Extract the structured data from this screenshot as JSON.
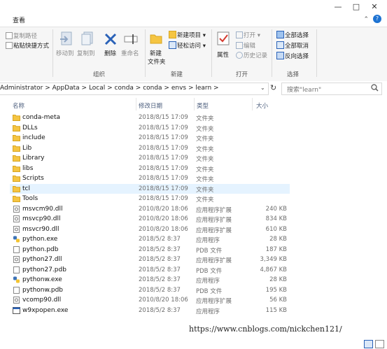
{
  "ribbon": {
    "view_tab": "查看",
    "clipboard": {
      "copy_path": "复制路径",
      "paste_shortcut": "粘贴快捷方式"
    },
    "organize": {
      "move_to": "移动到",
      "copy_to": "复制到",
      "delete": "删除",
      "rename": "重命名",
      "group_label": "组织"
    },
    "new": {
      "new_folder_line1": "新建",
      "new_folder_line2": "文件夹",
      "new_item": "新建项目 ▾",
      "easy_access": "轻松访问 ▾",
      "group_label": "新建"
    },
    "open": {
      "properties": "属性",
      "open": "打开 ▾",
      "edit": "编辑",
      "history": "历史记录",
      "group_label": "打开"
    },
    "select": {
      "select_all": "全部选择",
      "select_none": "全部取消",
      "invert": "反向选择",
      "group_label": "选择"
    }
  },
  "address": {
    "path": "Administrator  >  AppData  >  Local  >  conda  >  conda  >  envs  >  learn  >",
    "search_placeholder": "搜索\"learn\""
  },
  "columns": {
    "name": "名称",
    "date": "修改日期",
    "type": "类型",
    "size": "大小"
  },
  "files": [
    {
      "name": "conda-meta",
      "date": "2018/8/15 17:09",
      "type": "文件夹",
      "size": "",
      "icon": "folder"
    },
    {
      "name": "DLLs",
      "date": "2018/8/15 17:09",
      "type": "文件夹",
      "size": "",
      "icon": "folder"
    },
    {
      "name": "include",
      "date": "2018/8/15 17:09",
      "type": "文件夹",
      "size": "",
      "icon": "folder"
    },
    {
      "name": "Lib",
      "date": "2018/8/15 17:09",
      "type": "文件夹",
      "size": "",
      "icon": "folder"
    },
    {
      "name": "Library",
      "date": "2018/8/15 17:09",
      "type": "文件夹",
      "size": "",
      "icon": "folder"
    },
    {
      "name": "libs",
      "date": "2018/8/15 17:09",
      "type": "文件夹",
      "size": "",
      "icon": "folder"
    },
    {
      "name": "Scripts",
      "date": "2018/8/15 17:09",
      "type": "文件夹",
      "size": "",
      "icon": "folder"
    },
    {
      "name": "tcl",
      "date": "2018/8/15 17:09",
      "type": "文件夹",
      "size": "",
      "icon": "folder"
    },
    {
      "name": "Tools",
      "date": "2018/8/15 17:09",
      "type": "文件夹",
      "size": "",
      "icon": "folder"
    },
    {
      "name": "msvcm90.dll",
      "date": "2010/8/20 18:06",
      "type": "应用程序扩展",
      "size": "240 KB",
      "icon": "dll"
    },
    {
      "name": "msvcp90.dll",
      "date": "2010/8/20 18:06",
      "type": "应用程序扩展",
      "size": "834 KB",
      "icon": "dll"
    },
    {
      "name": "msvcr90.dll",
      "date": "2010/8/20 18:06",
      "type": "应用程序扩展",
      "size": "610 KB",
      "icon": "dll"
    },
    {
      "name": "python.exe",
      "date": "2018/5/2 8:37",
      "type": "应用程序",
      "size": "28 KB",
      "icon": "python"
    },
    {
      "name": "python.pdb",
      "date": "2018/5/2 8:37",
      "type": "PDB 文件",
      "size": "187 KB",
      "icon": "doc"
    },
    {
      "name": "python27.dll",
      "date": "2018/5/2 8:37",
      "type": "应用程序扩展",
      "size": "3,349 KB",
      "icon": "dll"
    },
    {
      "name": "python27.pdb",
      "date": "2018/5/2 8:37",
      "type": "PDB 文件",
      "size": "4,867 KB",
      "icon": "doc"
    },
    {
      "name": "pythonw.exe",
      "date": "2018/5/2 8:37",
      "type": "应用程序",
      "size": "28 KB",
      "icon": "python"
    },
    {
      "name": "pythonw.pdb",
      "date": "2018/5/2 8:37",
      "type": "PDB 文件",
      "size": "195 KB",
      "icon": "doc"
    },
    {
      "name": "vcomp90.dll",
      "date": "2010/8/20 18:06",
      "type": "应用程序扩展",
      "size": "56 KB",
      "icon": "dll"
    },
    {
      "name": "w9xpopen.exe",
      "date": "2018/5/2 8:37",
      "type": "应用程序",
      "size": "115 KB",
      "icon": "exe"
    }
  ],
  "selected_row": 7,
  "watermark": "https://www.cnblogs.com/nickchen121/",
  "colors": {
    "folder": "#f5c542",
    "accent": "#1e73d2",
    "selection": "#e5f3ff"
  }
}
